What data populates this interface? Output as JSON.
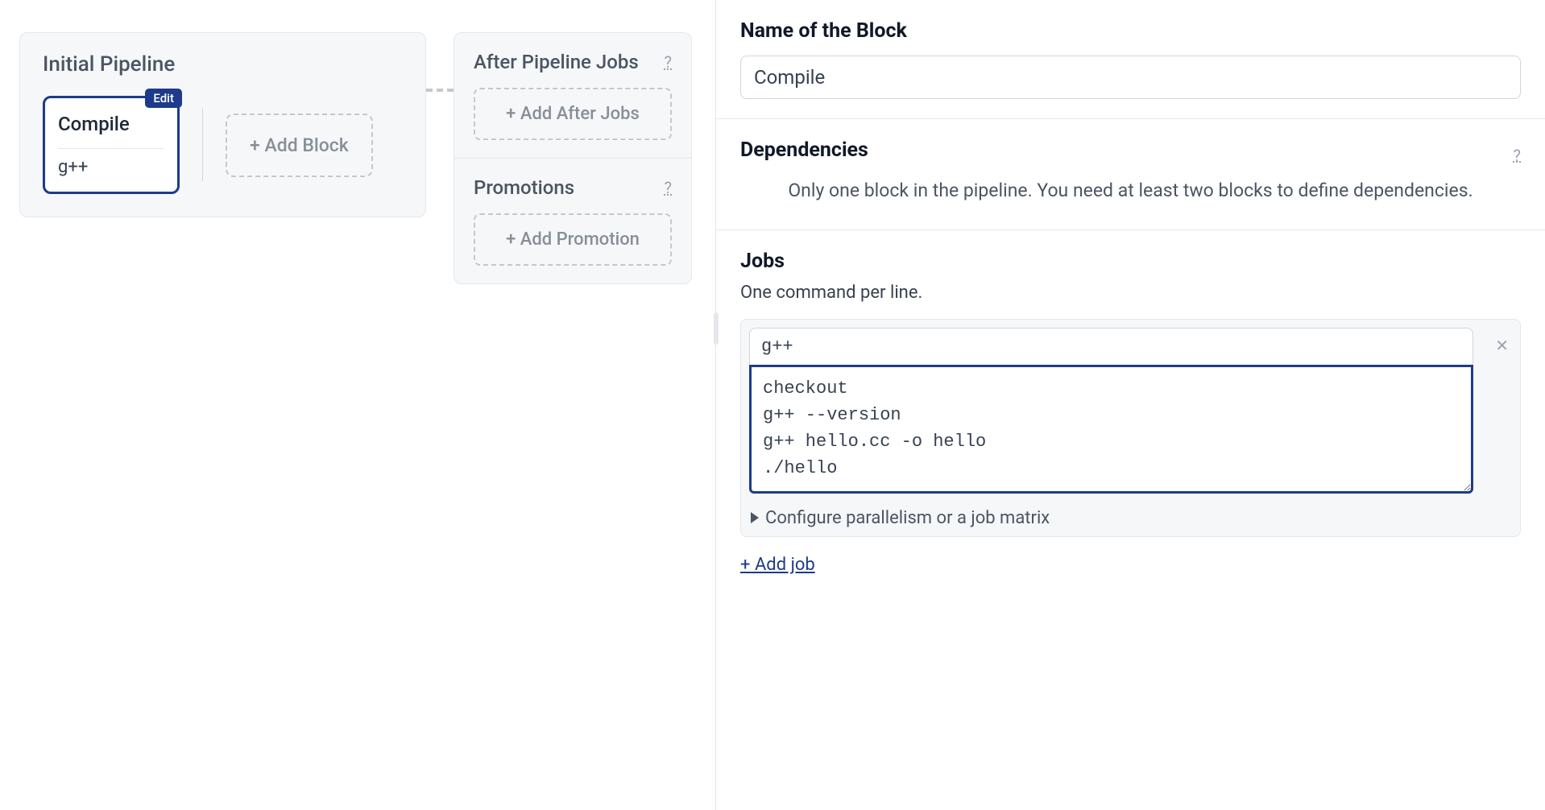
{
  "pipeline": {
    "title": "Initial Pipeline",
    "block": {
      "name": "Compile",
      "job": "g++",
      "edit_label": "Edit"
    },
    "add_block_label": "+ Add Block"
  },
  "after_pipeline": {
    "title": "After Pipeline Jobs",
    "add_label": "+ Add After Jobs"
  },
  "promotions": {
    "title": "Promotions",
    "add_label": "+ Add Promotion"
  },
  "detail": {
    "name_label": "Name of the Block",
    "name_value": "Compile",
    "dependencies_label": "Dependencies",
    "dependencies_message": "Only one block in the pipeline. You need at least two blocks to define dependencies.",
    "jobs_label": "Jobs",
    "jobs_subtitle": "One command per line.",
    "job": {
      "name": "g++",
      "commands": "checkout\ng++ --version\ng++ hello.cc -o hello\n./hello"
    },
    "configure_label": "Configure parallelism or a job matrix",
    "add_job_label": "+ Add job",
    "help_glyph": "?"
  }
}
